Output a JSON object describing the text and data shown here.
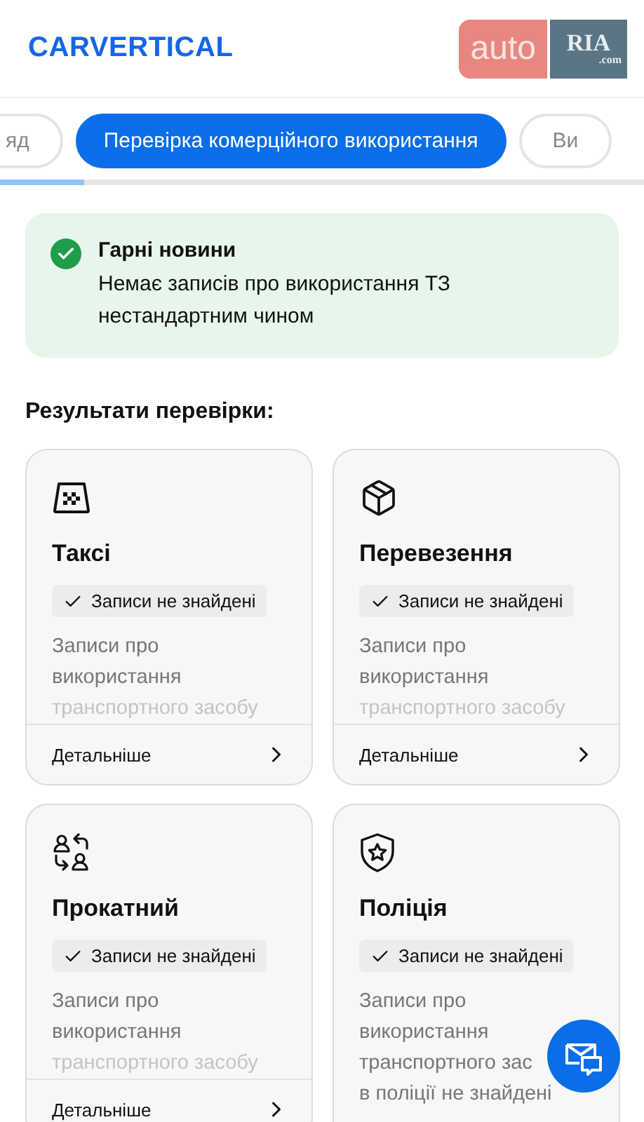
{
  "header": {
    "logo": "CARVERTICAL",
    "partner_logo": {
      "word": "auto",
      "mark": "RIA",
      "domain": ".com"
    }
  },
  "tabs": [
    {
      "label": "яд",
      "selected": false
    },
    {
      "label": "Перевірка комерційного використання",
      "selected": true
    },
    {
      "label": "Ви",
      "selected": false
    }
  ],
  "tab_progress": {
    "level": 0.13
  },
  "notice": {
    "title": "Гарні новини",
    "text": "Немає записів про використання ТЗ нестандартним чином"
  },
  "results_heading": "Результати перевірки:",
  "cards": [
    {
      "title": "Таксі",
      "status": "Записи не знайдені",
      "description": [
        "Записи про",
        "використання",
        "транспортного засобу"
      ],
      "expanded": false,
      "link": "Детальніше"
    },
    {
      "title": "Перевезення",
      "status": "Записи не знайдені",
      "description": [
        "Записи про",
        "використання",
        "транспортного засобу"
      ],
      "expanded": false,
      "link": "Детальніше"
    },
    {
      "title": "Прокатний",
      "status": "Записи не знайдені",
      "description": [
        "Записи про",
        "використання",
        "транспортного засобу"
      ],
      "expanded": false,
      "link": "Детальніше"
    },
    {
      "title": "Поліція",
      "status": "Записи не знайдені",
      "description": [
        "Записи про",
        "використання",
        "транспортного зас",
        "в поліції не знайдені"
      ],
      "expanded": true
    }
  ]
}
